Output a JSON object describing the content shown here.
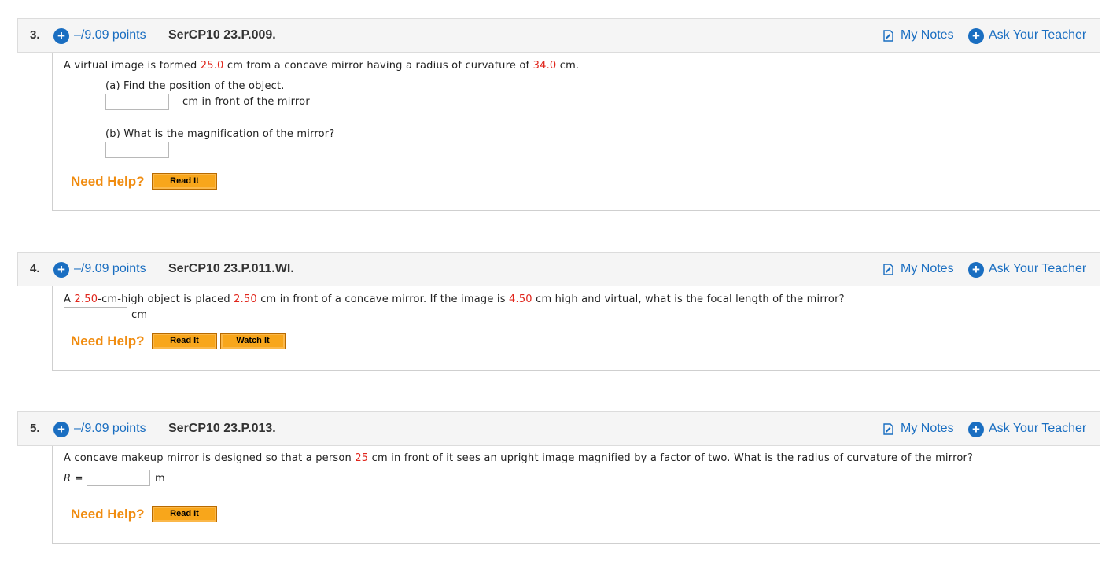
{
  "labels": {
    "points": "–/9.09 points",
    "my_notes": "My Notes",
    "ask_teacher": "Ask Your Teacher",
    "need_help": "Need Help?",
    "read_it": "Read It",
    "watch_it": "Watch It"
  },
  "colors": {
    "link_blue": "#1a6ec1",
    "value_red": "#e0251b",
    "help_orange": "#f08c10",
    "button_orange": "#f8a61b"
  },
  "questions": [
    {
      "number": "3.",
      "code": "SerCP10 23.P.009.",
      "prompt": {
        "t1": "A virtual image is formed ",
        "v1": "25.0",
        "t2": " cm from a concave mirror having a radius of curvature of ",
        "v2": "34.0",
        "t3": " cm."
      },
      "part_a": "(a) Find the position of the object.",
      "part_a_unit": "cm in front of the mirror",
      "part_a_value": "",
      "part_b": "(b) What is the magnification of the mirror?",
      "part_b_value": ""
    },
    {
      "number": "4.",
      "code": "SerCP10 23.P.011.WI.",
      "prompt": {
        "t1": "A ",
        "v1": "2.50",
        "t2": "-cm-high object is placed ",
        "v2": "2.50",
        "t3": " cm in front of a concave mirror. If the image is ",
        "v3": "4.50",
        "t4": " cm high and virtual, what is the focal length of the mirror?"
      },
      "unit": "cm",
      "value": ""
    },
    {
      "number": "5.",
      "code": "SerCP10 23.P.013.",
      "prompt": {
        "t1": "A concave makeup mirror is designed so that a person ",
        "v1": "25",
        "t2": " cm in front of it sees an upright image magnified by a factor of two. What is the radius of curvature of the mirror?"
      },
      "var_label": "R",
      "equals": " =",
      "unit": "m",
      "value": ""
    }
  ]
}
